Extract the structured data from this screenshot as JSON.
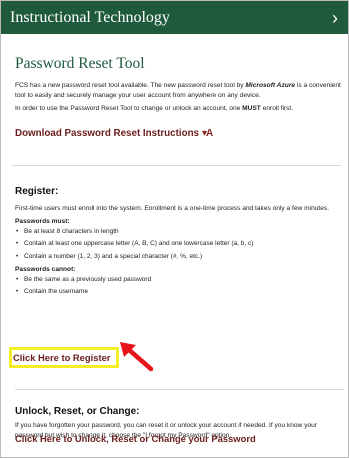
{
  "header": {
    "title": "Instructional Technology",
    "chevron_icon": "chevron-right-icon"
  },
  "tool": {
    "title": "Password Reset Tool",
    "intro_prefix": "FCS has a new password reset tool available. The new password reset tool by ",
    "intro_brand": "Microsoft Azure",
    "intro_suffix": " is a convenient tool to easily and securely manage your user account from anywhere on any device.",
    "enroll_prefix": "In order to use the Password Reset Tool to change or unlock an account, one ",
    "enroll_must": "MUST",
    "enroll_suffix": " enroll first.",
    "download_label": "Download Password Reset Instructions",
    "download_icon": "sort-az-icon"
  },
  "register": {
    "heading": "Register:",
    "description": "First-time users must enroll into the system. Enrollment is a one-time process and takes only a few minutes.",
    "must_label": "Passwords must:",
    "must_items": [
      "Be at least 8 characters in length",
      "Contain at least one uppercase letter (A, B, C) and one lowercase letter (a, b, c)",
      "Contain a number (1, 2, 3) and a special character (#, %, etc.)"
    ],
    "cannot_label": "Passwords cannot:",
    "cannot_items": [
      "Be the same as a previously used password",
      "Contain the username"
    ],
    "link_label": "Click Here to Register",
    "highlight_color": "#f4ee27",
    "arrow_color": "#e8141c"
  },
  "unlock": {
    "heading": "Unlock, Reset, or Change:",
    "description": "If you have forgotten your password, you can reset it or unlock your account if needed. If you know your password but wish to change it, choose the \"I forgot my Password\" option.",
    "link_label": "Click Here to Unlock, Reset or Change your Password"
  },
  "colors": {
    "header_bg": "#1f5a3c",
    "tool_title": "#1f5a3c",
    "link": "#6b1d1d"
  }
}
